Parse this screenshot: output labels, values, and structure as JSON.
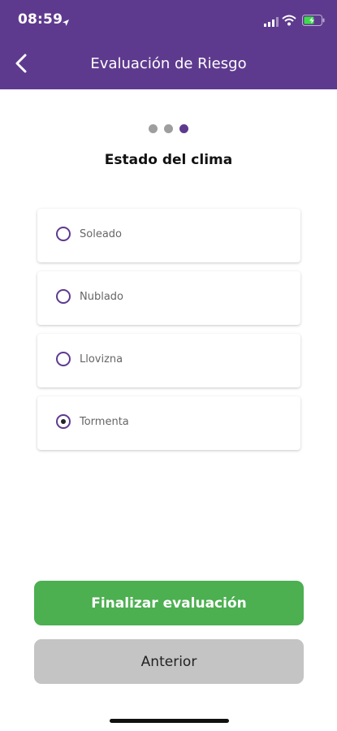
{
  "status_bar": {
    "time": "08:59"
  },
  "header": {
    "title": "Evaluación de Riesgo"
  },
  "steps": {
    "total": 3,
    "current": 3
  },
  "question": "Estado del clima",
  "options": [
    {
      "label": "Soleado",
      "selected": false
    },
    {
      "label": "Nublado",
      "selected": false
    },
    {
      "label": "Llovizna",
      "selected": false
    },
    {
      "label": "Tormenta",
      "selected": true
    }
  ],
  "actions": {
    "finish_label": "Finalizar evaluación",
    "previous_label": "Anterior"
  },
  "colors": {
    "primary": "#5e3a8f",
    "success": "#4caf50",
    "secondary": "#c4c4c4"
  }
}
